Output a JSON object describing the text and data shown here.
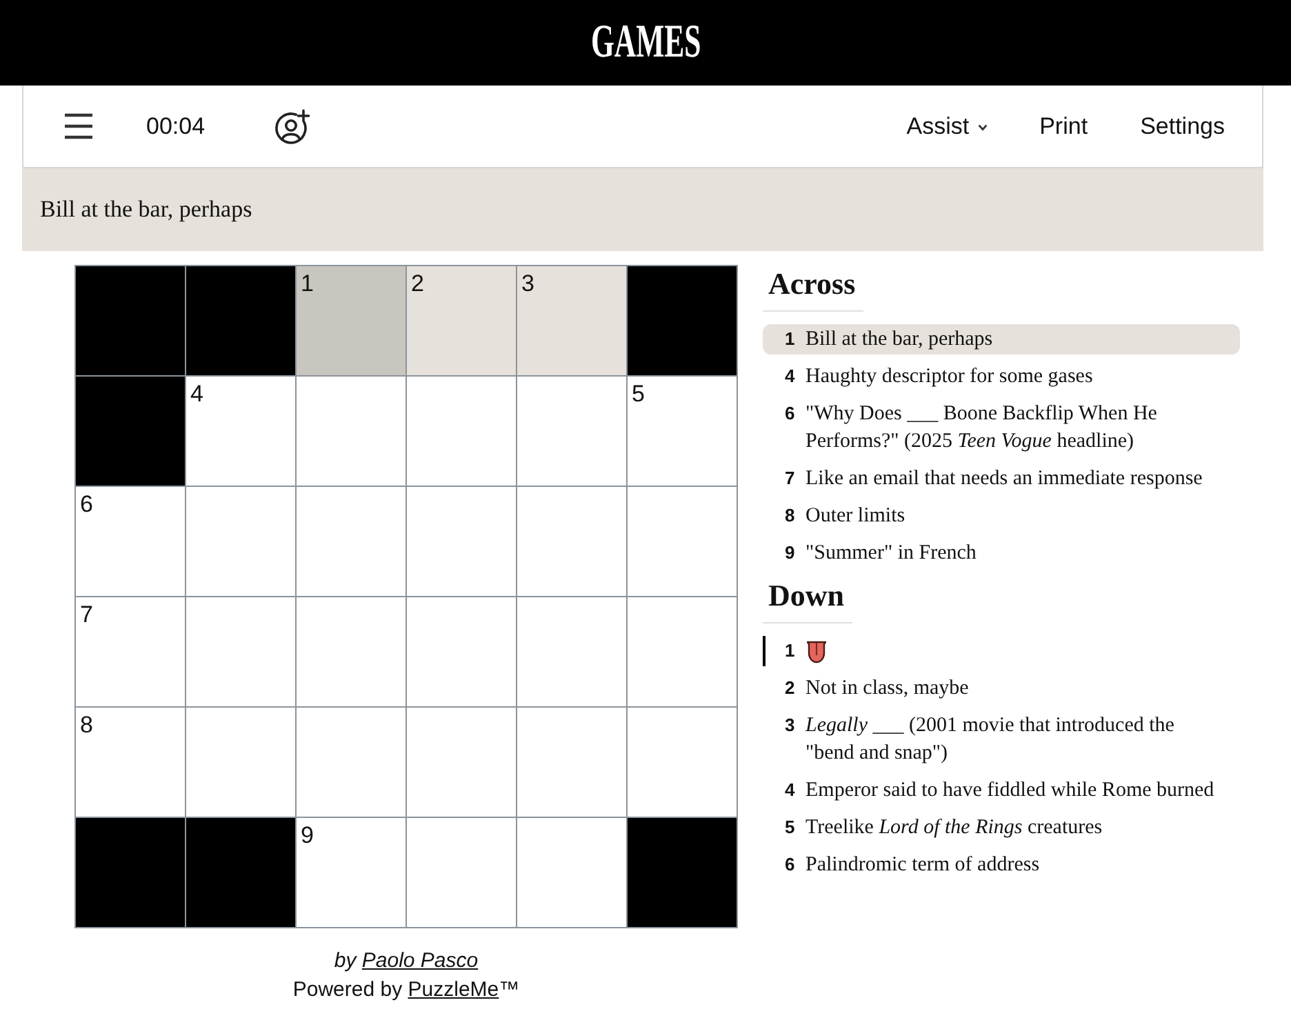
{
  "header": {
    "logo": "GAMES"
  },
  "toolbar": {
    "timer": "00:04",
    "menu_items": [
      {
        "label": "Assist",
        "dropdown": true
      },
      {
        "label": "Print",
        "dropdown": false
      },
      {
        "label": "Settings",
        "dropdown": false
      }
    ]
  },
  "current_clue": {
    "text": "Bill at the bar, perhaps"
  },
  "grid": {
    "rows": [
      [
        {
          "kind": "block"
        },
        {
          "kind": "block"
        },
        {
          "kind": "letter",
          "number": "1",
          "selected": true,
          "highlighted": false
        },
        {
          "kind": "letter",
          "number": "2",
          "selected": false,
          "highlighted": true
        },
        {
          "kind": "letter",
          "number": "3",
          "selected": false,
          "highlighted": true
        },
        {
          "kind": "block"
        }
      ],
      [
        {
          "kind": "block"
        },
        {
          "kind": "letter",
          "number": "4",
          "selected": false,
          "highlighted": false
        },
        {
          "kind": "letter",
          "selected": false,
          "highlighted": false
        },
        {
          "kind": "letter",
          "selected": false,
          "highlighted": false
        },
        {
          "kind": "letter",
          "selected": false,
          "highlighted": false
        },
        {
          "kind": "letter",
          "number": "5",
          "selected": false,
          "highlighted": false
        }
      ],
      [
        {
          "kind": "letter",
          "number": "6",
          "selected": false,
          "highlighted": false
        },
        {
          "kind": "letter",
          "selected": false,
          "highlighted": false
        },
        {
          "kind": "letter",
          "selected": false,
          "highlighted": false
        },
        {
          "kind": "letter",
          "selected": false,
          "highlighted": false
        },
        {
          "kind": "letter",
          "selected": false,
          "highlighted": false
        },
        {
          "kind": "letter",
          "selected": false,
          "highlighted": false
        }
      ],
      [
        {
          "kind": "letter",
          "number": "7",
          "selected": false,
          "highlighted": false
        },
        {
          "kind": "letter",
          "selected": false,
          "highlighted": false
        },
        {
          "kind": "letter",
          "selected": false,
          "highlighted": false
        },
        {
          "kind": "letter",
          "selected": false,
          "highlighted": false
        },
        {
          "kind": "letter",
          "selected": false,
          "highlighted": false
        },
        {
          "kind": "letter",
          "selected": false,
          "highlighted": false
        }
      ],
      [
        {
          "kind": "letter",
          "number": "8",
          "selected": false,
          "highlighted": false
        },
        {
          "kind": "letter",
          "selected": false,
          "highlighted": false
        },
        {
          "kind": "letter",
          "selected": false,
          "highlighted": false
        },
        {
          "kind": "letter",
          "selected": false,
          "highlighted": false
        },
        {
          "kind": "letter",
          "selected": false,
          "highlighted": false
        },
        {
          "kind": "letter",
          "selected": false,
          "highlighted": false
        }
      ],
      [
        {
          "kind": "block"
        },
        {
          "kind": "block"
        },
        {
          "kind": "letter",
          "number": "9",
          "selected": false,
          "highlighted": false
        },
        {
          "kind": "letter",
          "selected": false,
          "highlighted": false
        },
        {
          "kind": "letter",
          "selected": false,
          "highlighted": false
        },
        {
          "kind": "block"
        }
      ]
    ]
  },
  "byline": {
    "prefix": "by",
    "author": "Paolo Pasco"
  },
  "powered": {
    "prefix": "Powered by",
    "link": "PuzzleMe",
    "suffix": "™"
  },
  "clue_lists": [
    {
      "title": "Across",
      "clues": [
        {
          "number": "1",
          "kind": "text",
          "text": "Bill at the bar, perhaps",
          "selected": true,
          "crossing": false
        },
        {
          "number": "4",
          "kind": "text",
          "text": "Haughty descriptor for some gases",
          "selected": false,
          "crossing": false
        },
        {
          "number": "6",
          "kind": "text",
          "text": "\"Why Does ___ Boone Backflip When He Performs?\" (2025 *Teen Vogue* headline)",
          "selected": false,
          "crossing": false
        },
        {
          "number": "7",
          "kind": "text",
          "text": "Like an email that needs an immediate response",
          "selected": false,
          "crossing": false
        },
        {
          "number": "8",
          "kind": "text",
          "text": "Outer limits",
          "selected": false,
          "crossing": false
        },
        {
          "number": "9",
          "kind": "text",
          "text": "\"Summer\" in French",
          "selected": false,
          "crossing": false
        }
      ]
    },
    {
      "title": "Down",
      "clues": [
        {
          "number": "1",
          "kind": "picture",
          "selected": false,
          "crossing": true
        },
        {
          "number": "2",
          "kind": "text",
          "text": "Not in class, maybe",
          "selected": false,
          "crossing": false
        },
        {
          "number": "3",
          "kind": "text",
          "text": "*Legally* ___ (2001 movie that introduced the \"bend and snap\")",
          "selected": false,
          "crossing": false
        },
        {
          "number": "4",
          "kind": "text",
          "text": "Emperor said to have fiddled while Rome burned",
          "selected": false,
          "crossing": false
        },
        {
          "number": "5",
          "kind": "text",
          "text": "Treelike *Lord of the Rings* creatures",
          "selected": false,
          "crossing": false
        },
        {
          "number": "6",
          "kind": "text",
          "text": "Palindromic term of address",
          "selected": false,
          "crossing": false
        }
      ]
    }
  ]
}
